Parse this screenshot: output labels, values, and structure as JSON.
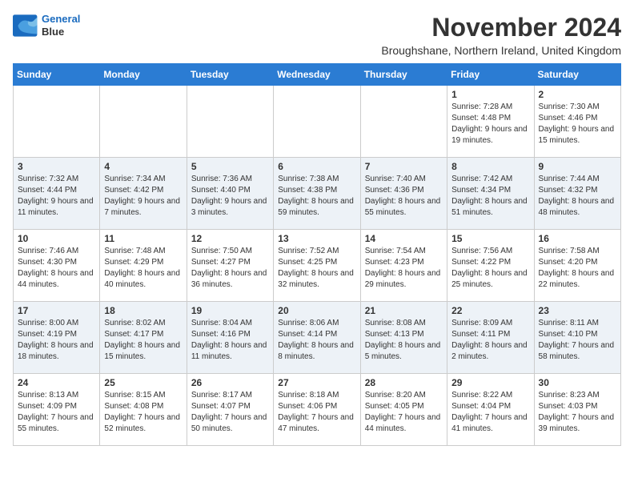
{
  "logo": {
    "line1": "General",
    "line2": "Blue"
  },
  "title": "November 2024",
  "subtitle": "Broughshane, Northern Ireland, United Kingdom",
  "days_of_week": [
    "Sunday",
    "Monday",
    "Tuesday",
    "Wednesday",
    "Thursday",
    "Friday",
    "Saturday"
  ],
  "weeks": [
    [
      {
        "day": "",
        "info": ""
      },
      {
        "day": "",
        "info": ""
      },
      {
        "day": "",
        "info": ""
      },
      {
        "day": "",
        "info": ""
      },
      {
        "day": "",
        "info": ""
      },
      {
        "day": "1",
        "info": "Sunrise: 7:28 AM\nSunset: 4:48 PM\nDaylight: 9 hours and 19 minutes."
      },
      {
        "day": "2",
        "info": "Sunrise: 7:30 AM\nSunset: 4:46 PM\nDaylight: 9 hours and 15 minutes."
      }
    ],
    [
      {
        "day": "3",
        "info": "Sunrise: 7:32 AM\nSunset: 4:44 PM\nDaylight: 9 hours and 11 minutes."
      },
      {
        "day": "4",
        "info": "Sunrise: 7:34 AM\nSunset: 4:42 PM\nDaylight: 9 hours and 7 minutes."
      },
      {
        "day": "5",
        "info": "Sunrise: 7:36 AM\nSunset: 4:40 PM\nDaylight: 9 hours and 3 minutes."
      },
      {
        "day": "6",
        "info": "Sunrise: 7:38 AM\nSunset: 4:38 PM\nDaylight: 8 hours and 59 minutes."
      },
      {
        "day": "7",
        "info": "Sunrise: 7:40 AM\nSunset: 4:36 PM\nDaylight: 8 hours and 55 minutes."
      },
      {
        "day": "8",
        "info": "Sunrise: 7:42 AM\nSunset: 4:34 PM\nDaylight: 8 hours and 51 minutes."
      },
      {
        "day": "9",
        "info": "Sunrise: 7:44 AM\nSunset: 4:32 PM\nDaylight: 8 hours and 48 minutes."
      }
    ],
    [
      {
        "day": "10",
        "info": "Sunrise: 7:46 AM\nSunset: 4:30 PM\nDaylight: 8 hours and 44 minutes."
      },
      {
        "day": "11",
        "info": "Sunrise: 7:48 AM\nSunset: 4:29 PM\nDaylight: 8 hours and 40 minutes."
      },
      {
        "day": "12",
        "info": "Sunrise: 7:50 AM\nSunset: 4:27 PM\nDaylight: 8 hours and 36 minutes."
      },
      {
        "day": "13",
        "info": "Sunrise: 7:52 AM\nSunset: 4:25 PM\nDaylight: 8 hours and 32 minutes."
      },
      {
        "day": "14",
        "info": "Sunrise: 7:54 AM\nSunset: 4:23 PM\nDaylight: 8 hours and 29 minutes."
      },
      {
        "day": "15",
        "info": "Sunrise: 7:56 AM\nSunset: 4:22 PM\nDaylight: 8 hours and 25 minutes."
      },
      {
        "day": "16",
        "info": "Sunrise: 7:58 AM\nSunset: 4:20 PM\nDaylight: 8 hours and 22 minutes."
      }
    ],
    [
      {
        "day": "17",
        "info": "Sunrise: 8:00 AM\nSunset: 4:19 PM\nDaylight: 8 hours and 18 minutes."
      },
      {
        "day": "18",
        "info": "Sunrise: 8:02 AM\nSunset: 4:17 PM\nDaylight: 8 hours and 15 minutes."
      },
      {
        "day": "19",
        "info": "Sunrise: 8:04 AM\nSunset: 4:16 PM\nDaylight: 8 hours and 11 minutes."
      },
      {
        "day": "20",
        "info": "Sunrise: 8:06 AM\nSunset: 4:14 PM\nDaylight: 8 hours and 8 minutes."
      },
      {
        "day": "21",
        "info": "Sunrise: 8:08 AM\nSunset: 4:13 PM\nDaylight: 8 hours and 5 minutes."
      },
      {
        "day": "22",
        "info": "Sunrise: 8:09 AM\nSunset: 4:11 PM\nDaylight: 8 hours and 2 minutes."
      },
      {
        "day": "23",
        "info": "Sunrise: 8:11 AM\nSunset: 4:10 PM\nDaylight: 7 hours and 58 minutes."
      }
    ],
    [
      {
        "day": "24",
        "info": "Sunrise: 8:13 AM\nSunset: 4:09 PM\nDaylight: 7 hours and 55 minutes."
      },
      {
        "day": "25",
        "info": "Sunrise: 8:15 AM\nSunset: 4:08 PM\nDaylight: 7 hours and 52 minutes."
      },
      {
        "day": "26",
        "info": "Sunrise: 8:17 AM\nSunset: 4:07 PM\nDaylight: 7 hours and 50 minutes."
      },
      {
        "day": "27",
        "info": "Sunrise: 8:18 AM\nSunset: 4:06 PM\nDaylight: 7 hours and 47 minutes."
      },
      {
        "day": "28",
        "info": "Sunrise: 8:20 AM\nSunset: 4:05 PM\nDaylight: 7 hours and 44 minutes."
      },
      {
        "day": "29",
        "info": "Sunrise: 8:22 AM\nSunset: 4:04 PM\nDaylight: 7 hours and 41 minutes."
      },
      {
        "day": "30",
        "info": "Sunrise: 8:23 AM\nSunset: 4:03 PM\nDaylight: 7 hours and 39 minutes."
      }
    ]
  ]
}
